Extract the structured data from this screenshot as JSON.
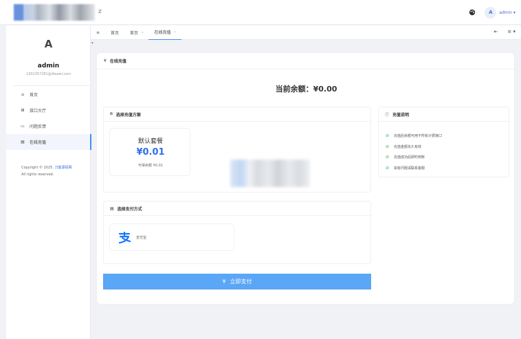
{
  "header": {
    "logo_tail": "z",
    "user": {
      "avatar": "A",
      "name": "admin ▾"
    }
  },
  "tabs": {
    "menu_icon": "≡",
    "items": [
      {
        "label": "首页",
        "sep": ""
      },
      {
        "label": "首页",
        "sep": "›"
      },
      {
        "label": "在线充值",
        "sep": "›"
      }
    ],
    "right_icons": [
      "⇤",
      "≡ ▾"
    ]
  },
  "sidebar": {
    "avatar": "A",
    "name": "admin",
    "email": "1302357281@dlaawl.com",
    "items": [
      {
        "icon": "home-icon",
        "glyph": "⌂",
        "label": "首页"
      },
      {
        "icon": "api-icon",
        "glyph": "⊞",
        "label": "接口大厅"
      },
      {
        "icon": "feedback-icon",
        "glyph": "▭",
        "label": "问题反馈"
      },
      {
        "icon": "card-icon",
        "glyph": "▤",
        "label": "在线充值"
      }
    ],
    "copyright_prefix": "Copyright © 2025. ",
    "copyright_link": "刀客源码网",
    "rights": "All rights reserved."
  },
  "main": {
    "title_icon": "¥",
    "title": "在线充值",
    "balance_label": "当前余额：",
    "balance_value": "¥0.00",
    "plan_section": {
      "icon": "⧈",
      "title": "选择充值方案",
      "plan": {
        "name": "默认套餐",
        "price": "¥0.01",
        "available": "可得余额 ¥0.01"
      }
    },
    "pay_section": {
      "icon": "▤",
      "title": "选择支付方式",
      "method": "支付宝"
    },
    "notes_section": {
      "icon": "ⓘ",
      "title": "充值说明",
      "items": [
        "充值后余额可用于所有计费接口",
        "充值金额永久有效",
        "充值成功后即时到账",
        "如有问题请联系客服"
      ]
    },
    "pay_button": {
      "icon": "¥",
      "label": "立即支付"
    }
  },
  "colors": {
    "accent": "#2f6fe6",
    "button": "#5aa6f7",
    "check": "#3aa55a"
  }
}
